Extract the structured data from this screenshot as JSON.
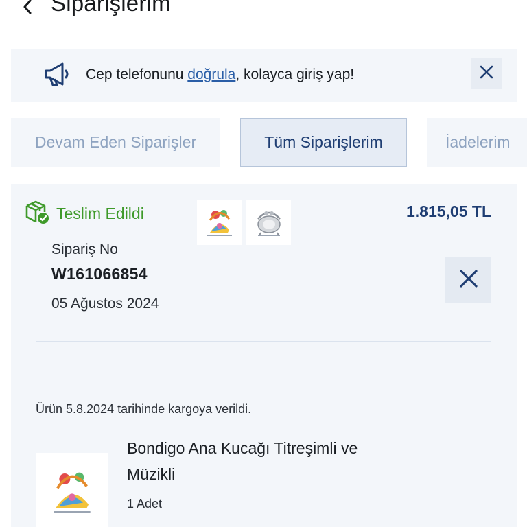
{
  "header": {
    "title": "Siparişlerim",
    "back_icon": "chevron-left-icon"
  },
  "banner": {
    "icon": "megaphone-icon",
    "text_before": "Cep telefonunu ",
    "link_label": "doğrula",
    "text_after": ", kolayca giriş yap!",
    "close_icon": "close-icon"
  },
  "tabs": [
    {
      "label": "Devam Eden Siparişler",
      "active": false
    },
    {
      "label": "Tüm Siparişlerim",
      "active": true
    },
    {
      "label": "İadelerim",
      "active": false
    }
  ],
  "order": {
    "status": "Teslim Edildi",
    "status_color": "#3f9a2a",
    "status_icon": "package-check-icon",
    "total": "1.815,05 TL",
    "order_no_label": "Sipariş No",
    "order_no": "W161066854",
    "date": "05 Ağustos 2024",
    "thumbnails": [
      "baby-bouncer-colorful",
      "baby-bouncer-grey"
    ],
    "shipped_note": "Ürün 5.8.2024 tarihinde kargoya verildi.",
    "item": {
      "name": "Bondigo Ana Kucağı Titreşimli ve Müzikli",
      "quantity": "1 Adet"
    }
  },
  "colors": {
    "accent": "#1f3e73",
    "link": "#2a5ea7",
    "panel_bg": "#f3f6fa",
    "inactive_tab_text": "#8ea3c0"
  }
}
